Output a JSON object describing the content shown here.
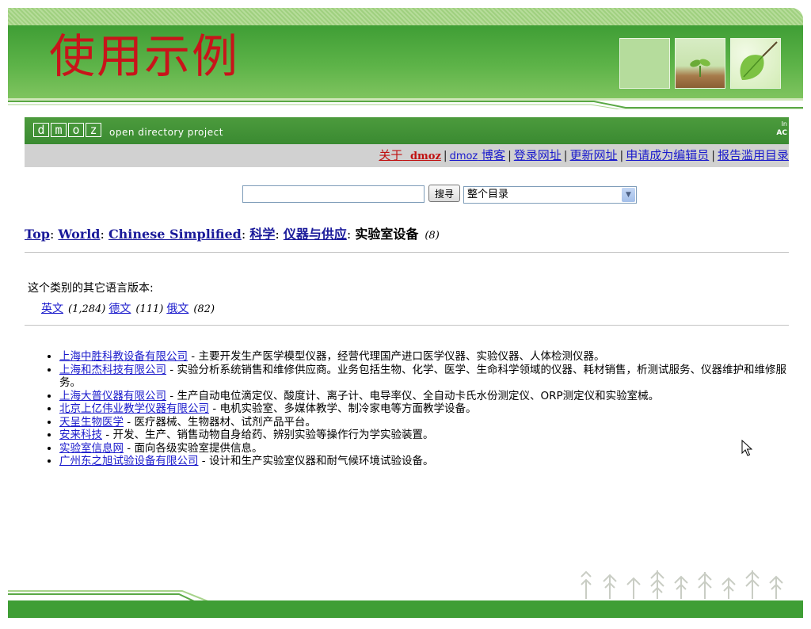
{
  "slide": {
    "title": "使用示例"
  },
  "dmoz": {
    "logo_letters": [
      "d",
      "m",
      "o",
      "z"
    ],
    "tagline": "open directory project",
    "corner_top": "In",
    "corner_bottom": "AC"
  },
  "nav": {
    "about_prefix": "关于",
    "about_brand": "dmoz",
    "blog_prefix": "dmoz",
    "blog_suffix": "博客",
    "login": "登录网址",
    "update": "更新网址",
    "apply_editor": "申请成为编辑员",
    "report_abuse": "报告滥用目录"
  },
  "search": {
    "input_value": "",
    "button_label": "搜寻",
    "scope_selected": "整个目录"
  },
  "breadcrumb": {
    "top": "Top",
    "world": "World",
    "chinese": "Chinese Simplified",
    "science": "科学",
    "instruments": "仪器与供应",
    "current": "实验室设备",
    "count": "(8)"
  },
  "languages": {
    "label": "这个类别的其它语言版本:",
    "items": [
      {
        "name": "英文",
        "count": "(1,284)"
      },
      {
        "name": "德文",
        "count": "(111)"
      },
      {
        "name": "俄文",
        "count": "(82)"
      }
    ]
  },
  "sites": [
    {
      "name": "上海中胜科教设备有限公司",
      "desc": " - 主要开发生产医学模型仪器，经营代理国产进口医学仪器、实验仪器、人体检测仪器。"
    },
    {
      "name": "上海和杰科技有限公司",
      "desc": " - 实验分析系统销售和维修供应商。业务包括生物、化学、医学、生命科学领域的仪器、耗材销售，析测试服务、仪器维护和维修服务。"
    },
    {
      "name": "上海大普仪器有限公司",
      "desc": " - 生产自动电位滴定仪、酸度计、离子计、电导率仪、全自动卡氏水份测定仪、ORP测定仪和实验室械。"
    },
    {
      "name": "北京上亿伟业教学仪器有限公司",
      "desc": " - 电机实验室、多媒体教学、制冷家电等方面教学设备。"
    },
    {
      "name": "天呈生物医学",
      "desc": " - 医疗器械、生物器材、试剂产品平台。"
    },
    {
      "name": "安来科技",
      "desc": " - 开发、生产、销售动物自身给药、辨别实验等操作行为学实验装置。"
    },
    {
      "name": "实验室信息网",
      "desc": " - 面向各级实验室提供信息。"
    },
    {
      "name": "广州东之旭试验设备有限公司",
      "desc": " - 设计和生产实验室仪器和耐气候环境试验设备。"
    }
  ],
  "colors": {
    "slide_green": "#3f9e35",
    "title_red": "#c8141a",
    "link_blue": "#1a1acc",
    "nav_gray": "#d1d1d1"
  }
}
